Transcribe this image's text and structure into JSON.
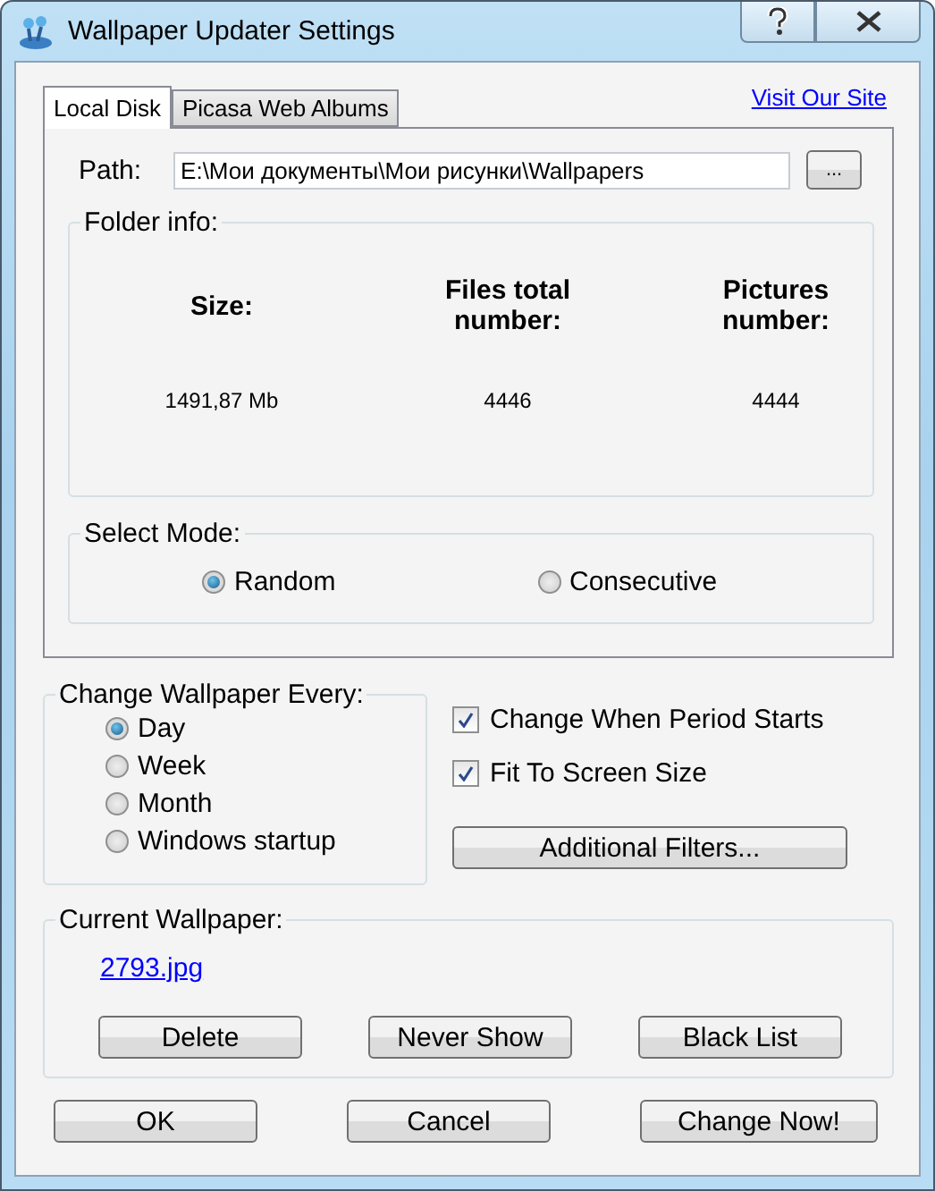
{
  "window": {
    "title": "Wallpaper Updater Settings"
  },
  "tabs": [
    {
      "label": "Local Disk",
      "selected": true
    },
    {
      "label": "Picasa Web Albums",
      "selected": false
    }
  ],
  "site_link": "Visit Our Site",
  "path": {
    "label": "Path:",
    "value": "E:\\Мои документы\\Мои рисунки\\Wallpapers",
    "browse": "..."
  },
  "folder_info": {
    "title": "Folder info:",
    "columns": [
      {
        "header": "Size:",
        "value": "1491,87 Mb"
      },
      {
        "header": "Files total number:",
        "value": "4446"
      },
      {
        "header": "Pictures number:",
        "value": "4444"
      }
    ]
  },
  "select_mode": {
    "title": "Select Mode:",
    "options": [
      {
        "label": "Random",
        "selected": true
      },
      {
        "label": "Consecutive",
        "selected": false
      }
    ]
  },
  "change_every": {
    "title": "Change Wallpaper Every:",
    "options": [
      {
        "label": "Day",
        "selected": true
      },
      {
        "label": "Week",
        "selected": false
      },
      {
        "label": "Month",
        "selected": false
      },
      {
        "label": "Windows startup",
        "selected": false
      }
    ]
  },
  "checkboxes": [
    {
      "label": "Change When Period Starts",
      "checked": true
    },
    {
      "label": "Fit To Screen Size",
      "checked": true
    }
  ],
  "filters_button": "Additional Filters...",
  "current_wallpaper": {
    "title": "Current Wallpaper:",
    "file": "2793.jpg",
    "buttons": [
      "Delete",
      "Never Show",
      "Black List"
    ]
  },
  "footer_buttons": [
    "OK",
    "Cancel",
    "Change Now!"
  ]
}
